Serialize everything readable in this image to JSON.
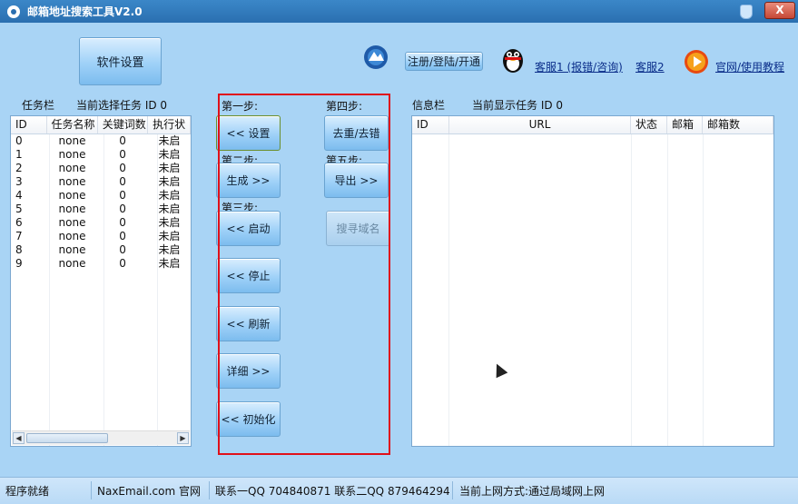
{
  "window": {
    "title": "邮箱地址搜索工具V2.0",
    "close_label": "X"
  },
  "toolbar": {
    "settings_button": "软件设置",
    "register_button": "注册/登陆/开通",
    "support1_link": "客服1 (报错/咨询)",
    "support2_link": "客服2",
    "website_link": "官网/使用教程"
  },
  "task_panel": {
    "title": "任务栏",
    "current_label": "当前选择任务 ID 0",
    "columns": [
      "ID",
      "任务名称",
      "关键词数",
      "执行状"
    ],
    "rows": [
      [
        "0",
        "none",
        "0",
        "未启"
      ],
      [
        "1",
        "none",
        "0",
        "未启"
      ],
      [
        "2",
        "none",
        "0",
        "未启"
      ],
      [
        "3",
        "none",
        "0",
        "未启"
      ],
      [
        "4",
        "none",
        "0",
        "未启"
      ],
      [
        "5",
        "none",
        "0",
        "未启"
      ],
      [
        "6",
        "none",
        "0",
        "未启"
      ],
      [
        "7",
        "none",
        "0",
        "未启"
      ],
      [
        "8",
        "none",
        "0",
        "未启"
      ],
      [
        "9",
        "none",
        "0",
        "未启"
      ]
    ]
  },
  "steps": {
    "step1": "第一步:",
    "step2": "第二步:",
    "step3": "第三步:",
    "step4": "第四步:",
    "step5": "第五步:",
    "set_btn": "<< 设置",
    "generate_btn": "生成 >>",
    "start_btn": "<< 启动",
    "stop_btn": "<< 停止",
    "refresh_btn": "<< 刷新",
    "detail_btn": "详细 >>",
    "init_btn": "<< 初始化",
    "dedupe_btn": "去重/去错",
    "export_btn": "导出 >>",
    "search_domain_btn": "搜寻域名"
  },
  "info_panel": {
    "title": "信息栏",
    "current_label": "当前显示任务 ID 0",
    "columns": [
      "ID",
      "URL",
      "状态",
      "邮箱",
      "邮箱数"
    ]
  },
  "statusbar": {
    "ready": "程序就绪",
    "site": "NaxEmail.com 官网",
    "contact": "联系一QQ 704840871 联系二QQ 879464294",
    "network": "当前上网方式:通过局域网上网"
  },
  "colors": {
    "accent": "#2a6fb0",
    "background": "#a9d4f5",
    "highlight_box": "#e0101a"
  }
}
